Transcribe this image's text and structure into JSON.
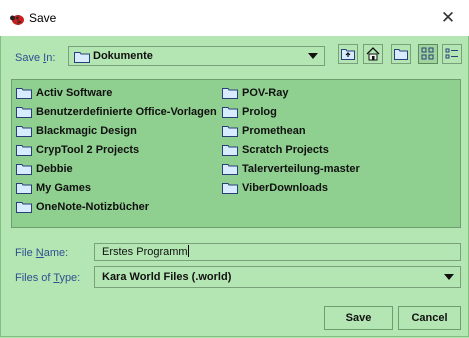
{
  "window": {
    "title": "Save",
    "close_icon": "close-icon"
  },
  "save_in": {
    "label_prefix": "Save ",
    "label_accel": "I",
    "label_suffix": "n:",
    "value": "Dokumente"
  },
  "toolbar": {
    "buttons": [
      "up-one-level-icon",
      "home-icon",
      "new-folder-icon",
      "list-view-icon",
      "details-view-icon"
    ],
    "active": "list-view-icon"
  },
  "files": {
    "column1": [
      "Activ Software",
      "Benutzerdefinierte Office-Vorlagen",
      "Blackmagic Design",
      "CrypTool 2 Projects",
      "Debbie",
      "My Games",
      "OneNote-Notizbücher"
    ],
    "column2": [
      "POV-Ray",
      "Prolog",
      "Promethean",
      "Scratch Projects",
      "Talerverteilung-master",
      "ViberDownloads"
    ]
  },
  "file_name": {
    "label_prefix": "File ",
    "label_accel": "N",
    "label_suffix": "ame:",
    "value": "Erstes Programm"
  },
  "files_of_type": {
    "label_prefix": "Files of ",
    "label_accel": "T",
    "label_suffix": "ype:",
    "value": "Kara World Files (.world)"
  },
  "buttons": {
    "save": "Save",
    "cancel": "Cancel"
  },
  "colors": {
    "background": "#b4e6b4",
    "list_background": "#8fcf8f",
    "label": "#2f4f8f"
  }
}
